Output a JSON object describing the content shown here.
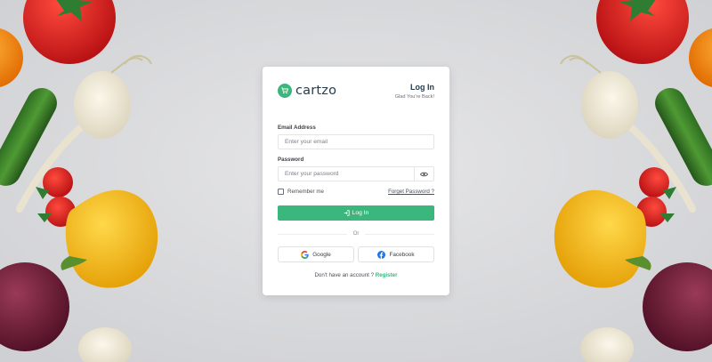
{
  "brand": {
    "name": "cartzo"
  },
  "header": {
    "title": "Log In",
    "subtitle": "Glad You're Back!"
  },
  "form": {
    "email_label": "Email Address",
    "email_placeholder": "Enter your email",
    "password_label": "Password",
    "password_placeholder": "Enter your password",
    "remember_label": "Remember me",
    "forgot_label": "Forget Password ?",
    "submit_label": "Log In"
  },
  "divider": {
    "label": "Or"
  },
  "social": {
    "google_label": "Google",
    "facebook_label": "Facebook"
  },
  "footer": {
    "prompt": "Don't have an account ?",
    "register_label": "Register"
  },
  "colors": {
    "accent": "#3bb77e",
    "text": "#253d4e",
    "background": "#d9d9dc"
  },
  "icons": [
    "cart-icon",
    "eye-icon",
    "login-arrow-icon",
    "google-icon",
    "facebook-icon"
  ]
}
